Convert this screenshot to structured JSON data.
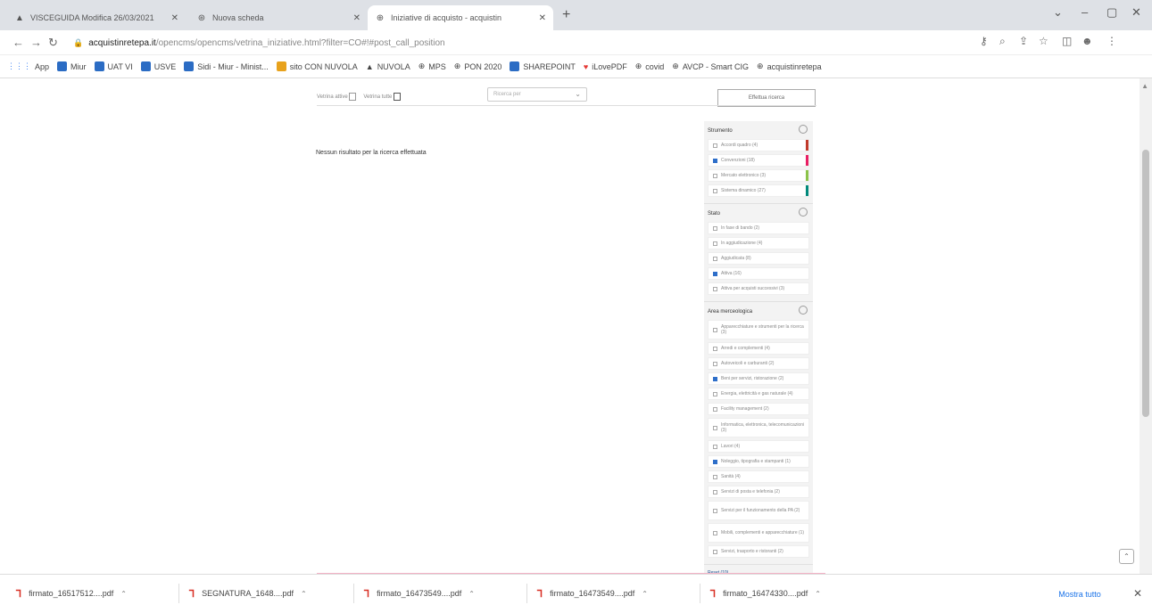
{
  "tabs": [
    {
      "title": "VISCEGUIDA Modifica 26/03/2021",
      "icon": "cloud-icon"
    },
    {
      "title": "Nuova scheda",
      "icon": "chrome-icon"
    },
    {
      "title": "Iniziative di acquisto - acquistin",
      "icon": "globe-icon"
    }
  ],
  "address": {
    "host": "acquistinretepa.it",
    "path": "/opencms/opencms/vetrina_iniziative.html?filter=CO#!#post_call_position"
  },
  "bookmarks": [
    {
      "label": "App",
      "color": "#4285f4"
    },
    {
      "label": "Miur",
      "color": "#2b6cc4"
    },
    {
      "label": "UAT VI",
      "color": "#2b6cc4"
    },
    {
      "label": "USVE",
      "color": "#2b6cc4"
    },
    {
      "label": "Sidi - Miur - Minist...",
      "color": "#2b6cc4"
    },
    {
      "label": "sito CON NUVOLA",
      "color": "#e8a21c"
    },
    {
      "label": "NUVOLA",
      "color": "#222222"
    },
    {
      "label": "MPS",
      "color": "#555555"
    },
    {
      "label": "PON 2020",
      "color": "#555555"
    },
    {
      "label": "SHAREPOINT",
      "color": "#2b6cc4"
    },
    {
      "label": "iLovePDF",
      "color": "#e53935"
    },
    {
      "label": "covid",
      "color": "#555555"
    },
    {
      "label": "AVCP - Smart CIG",
      "color": "#555555"
    },
    {
      "label": "acquistinretepa",
      "color": "#555555"
    }
  ],
  "filters": {
    "label_a": "Vetrina attive",
    "label_b": "Vetrina tutte",
    "select_placeholder": "Ricerca per",
    "apply_button": "Effettua ricerca"
  },
  "no_result": "Nessun risultato per la ricerca effettuata",
  "sidebar": {
    "sections": [
      {
        "title": "Strumento",
        "options": [
          {
            "label": "Accordi quadro (4)",
            "checked": false,
            "bar": "#c0392b"
          },
          {
            "label": "Convenzioni (18)",
            "checked": true,
            "bar": "#e91e63"
          },
          {
            "label": "Mercato elettronico (3)",
            "checked": false,
            "bar": "#8bc34a"
          },
          {
            "label": "Sistema dinamico (27)",
            "checked": false,
            "bar": "#00897b"
          }
        ]
      },
      {
        "title": "Stato",
        "options": [
          {
            "label": "In fase di bando (2)",
            "checked": false
          },
          {
            "label": "In aggiudicazione (4)",
            "checked": false
          },
          {
            "label": "Aggiudicata (8)",
            "checked": false
          },
          {
            "label": "Attiva (16)",
            "checked": true
          },
          {
            "label": "Attiva per acquisti successivi (3)",
            "checked": false
          }
        ]
      },
      {
        "title": "Area merceologica",
        "options": [
          {
            "label": "Apparecchiature e strumenti per la ricerca (3)",
            "checked": false,
            "tall": true
          },
          {
            "label": "Arredi e complementi (4)",
            "checked": false
          },
          {
            "label": "Autoveicoli e carburanti (2)",
            "checked": false
          },
          {
            "label": "Beni per servizi, ristorazione (2)",
            "checked": true
          },
          {
            "label": "Energia, elettricità e gas naturale (4)",
            "checked": false
          },
          {
            "label": "Facility management (2)",
            "checked": false
          },
          {
            "label": "Informatica, elettronica, telecomunicazioni (3)",
            "checked": false,
            "tall": true
          },
          {
            "label": "Lavori (4)",
            "checked": false
          },
          {
            "label": "Noleggio, tipografia e stampanti (1)",
            "checked": true
          },
          {
            "label": "Sanità (4)",
            "checked": false
          },
          {
            "label": "Servizi di posta e telefonia (2)",
            "checked": false
          },
          {
            "label": "Servizi per il funzionamento della PA (2)",
            "checked": false,
            "tall": true
          },
          {
            "label": "Mobili, complementi e apparecchiature (1)",
            "checked": false,
            "tall": true
          },
          {
            "label": "Servizi, trasporto e ristoranti (2)",
            "checked": false
          }
        ]
      }
    ],
    "reset_link": "Reset (10)"
  },
  "downloads": [
    {
      "name": "firmato_16517512....pdf"
    },
    {
      "name": "SEGNATURA_1648....pdf"
    },
    {
      "name": "firmato_16473549....pdf"
    },
    {
      "name": "firmato_16473549....pdf"
    },
    {
      "name": "firmato_16474330....pdf"
    }
  ],
  "downloads_show_all": "Mostra tutto"
}
